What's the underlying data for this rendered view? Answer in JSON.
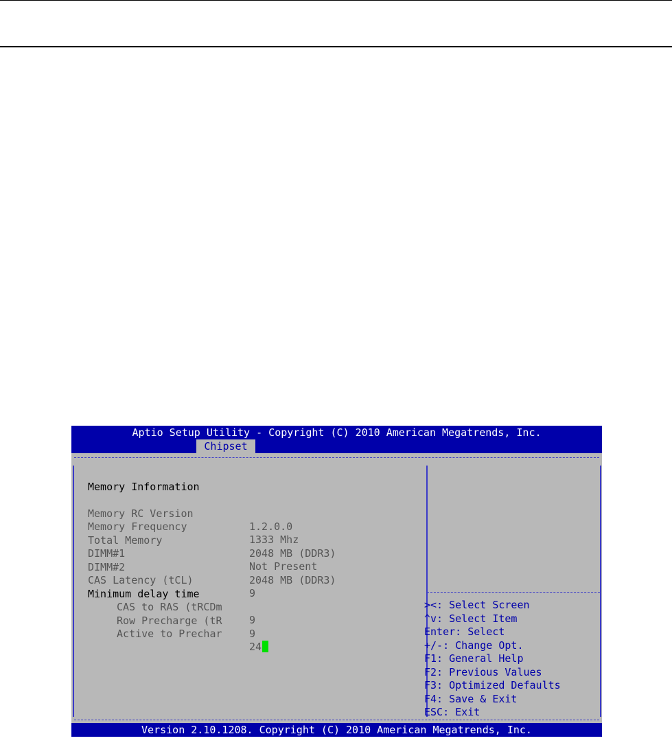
{
  "window": {
    "title": "Aptio Setup Utility - Copyright (C) 2010 American Megatrends, Inc.",
    "active_tab": "Chipset",
    "footer": "Version 2.10.1208. Copyright (C) 2010 American Megatrends, Inc."
  },
  "main": {
    "section_title": "Memory Information",
    "rows": [
      {
        "label": "Memory RC Version",
        "value": "1.2.0.0"
      },
      {
        "label": "Memory Frequency",
        "value": "1333 Mhz"
      },
      {
        "label": "Total Memory",
        "value": "2048 MB (DDR3)"
      },
      {
        "label": "DIMM#1",
        "value": "Not Present"
      },
      {
        "label": "DIMM#2",
        "value": "2048 MB (DDR3)"
      },
      {
        "label": "CAS Latency (tCL)",
        "value": "9"
      }
    ],
    "subsection_title": "Minimum delay time",
    "sub_rows": [
      {
        "label": "CAS to RAS (tRCDm",
        "value": "9"
      },
      {
        "label": "Row Precharge (tR",
        "value": "9"
      },
      {
        "label": "Active to Prechar",
        "value": "24"
      }
    ]
  },
  "help": {
    "keys": [
      "><: Select Screen",
      "^v: Select Item",
      "Enter: Select",
      "+/-: Change Opt.",
      "F1: General Help",
      "F2: Previous Values",
      "F3: Optimized Defaults",
      "F4: Save & Exit",
      "ESC: Exit"
    ]
  },
  "colors": {
    "header_bg": "#0000aa",
    "panel_bg": "#b8b8b8",
    "cursor": "#00e000"
  }
}
